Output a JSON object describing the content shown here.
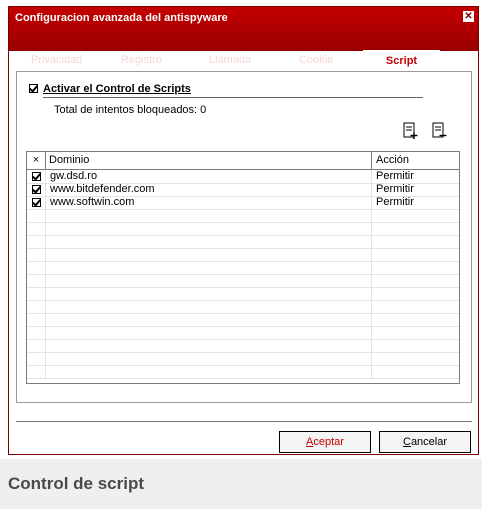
{
  "window": {
    "title": "Configuracion avanzada del antispyware"
  },
  "tabs": [
    {
      "label": "Privacidad",
      "active": false
    },
    {
      "label": "Registro",
      "active": false
    },
    {
      "label": "Llamada",
      "active": false
    },
    {
      "label": "Cookie",
      "active": false
    },
    {
      "label": "Script",
      "active": true
    }
  ],
  "script_control": {
    "enable_label": "Activar el Control de Scripts",
    "enable_checked": true,
    "blocked_text": "Total de intentos bloqueados: 0"
  },
  "toolbar_icons": [
    "add-domain-icon",
    "remove-domain-icon"
  ],
  "table": {
    "headers": {
      "check": "×",
      "domain": "Dominio",
      "action": "Acción"
    },
    "rows": [
      {
        "checked": true,
        "domain": "gw.dsd.ro",
        "action": "Permitir"
      },
      {
        "checked": true,
        "domain": "www.bitdefender.com",
        "action": "Permitir"
      },
      {
        "checked": true,
        "domain": "www.softwin.com",
        "action": "Permitir"
      }
    ]
  },
  "buttons": {
    "accept_prefix": "A",
    "accept_rest": "ceptar",
    "cancel_prefix": "C",
    "cancel_rest": "ancelar"
  },
  "caption": "Control de script",
  "colors": {
    "accent": "#c40000",
    "title_bar": "#b00000"
  }
}
